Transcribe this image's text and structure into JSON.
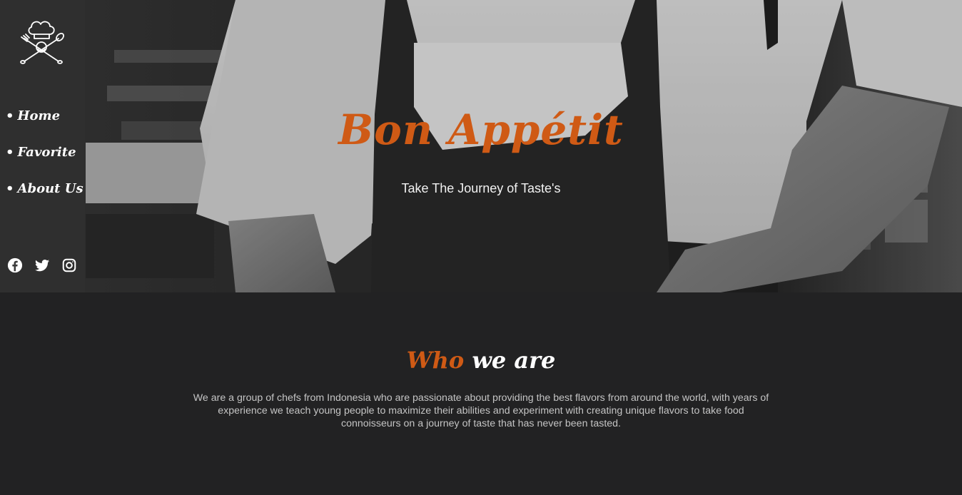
{
  "hero": {
    "title": "Bon Appétit",
    "subtitle": "Take The Journey of Taste's"
  },
  "sidebar": {
    "logo_icon": "chef-hat-crossed-utensils-icon",
    "nav": [
      {
        "label": "Home"
      },
      {
        "label": "Favorite"
      },
      {
        "label": "About Us"
      }
    ],
    "socials": [
      {
        "icon": "facebook-icon"
      },
      {
        "icon": "twitter-icon"
      },
      {
        "icon": "instagram-icon"
      }
    ]
  },
  "about": {
    "title_accent": "Who",
    "title_rest": "we are",
    "text": "We are a group of chefs from Indonesia who are passionate about providing the best flavors from around the world, with years of experience we teach young people to maximize their abilities and experiment with creating unique flavors to take food connoisseurs on a journey of taste that has never been tasted."
  },
  "colors": {
    "accent": "#cf5a15",
    "background": "#222223",
    "sidebar": "#303030"
  }
}
